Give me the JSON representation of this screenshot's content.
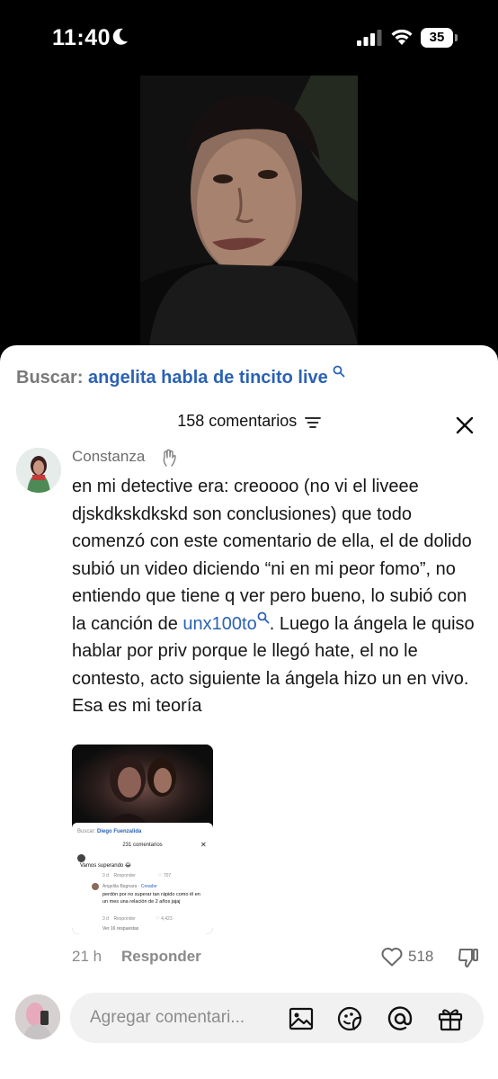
{
  "status_bar": {
    "time": "11:40",
    "battery": "35"
  },
  "search": {
    "label": "Buscar:",
    "query": "angelita habla de tincito live"
  },
  "comments": {
    "count_label": "158 comentarios"
  },
  "comment": {
    "author": "Constanza",
    "text_before_link": "en mi detective era: creoooo (no vi el liveee djskdkskdkskd son conclusiones) que todo comenzó con este comentario de ella, el de dolido subió un video diciendo “ni en mi peor fomo”, no entiendo que tiene q ver pero bueno, lo subió con la canción de ",
    "link": "unx100to",
    "text_after_link": ". Luego la ángela le quiso hablar por priv porque le llegó hate, el no le contesto, acto siguiente la ángela hizo un en vivo. Esa es mi teoría",
    "time_ago": "21 h",
    "reply_label": "Responder",
    "likes": "518",
    "attachment": {
      "search_label": "Buscar:",
      "search_query": "Diego Fuenzalida",
      "count_label": "231 comentarios",
      "first_comment": "Vamos superando 😂",
      "first_meta_ago": "3 d",
      "first_meta_reply": "Responder",
      "first_meta_likes": "707",
      "reply_author": "Angelita Bagnara",
      "reply_badge": "Creador",
      "reply_text": "perdón por no superar tan rápido como él en un mes una relación de 2 años jajaj",
      "reply_meta_ago": "3 d",
      "reply_meta_reply": "Responder",
      "reply_meta_likes": "4,423",
      "more_replies": "Ver 16 respuestas"
    }
  },
  "composer": {
    "placeholder": "Agregar comentari..."
  },
  "icons": {
    "image": "image-icon",
    "sticker": "sticker-icon",
    "mention": "mention-icon",
    "gift": "gift-icon"
  },
  "colors": {
    "link": "#2b62b4",
    "muted": "#8a8a8a"
  }
}
